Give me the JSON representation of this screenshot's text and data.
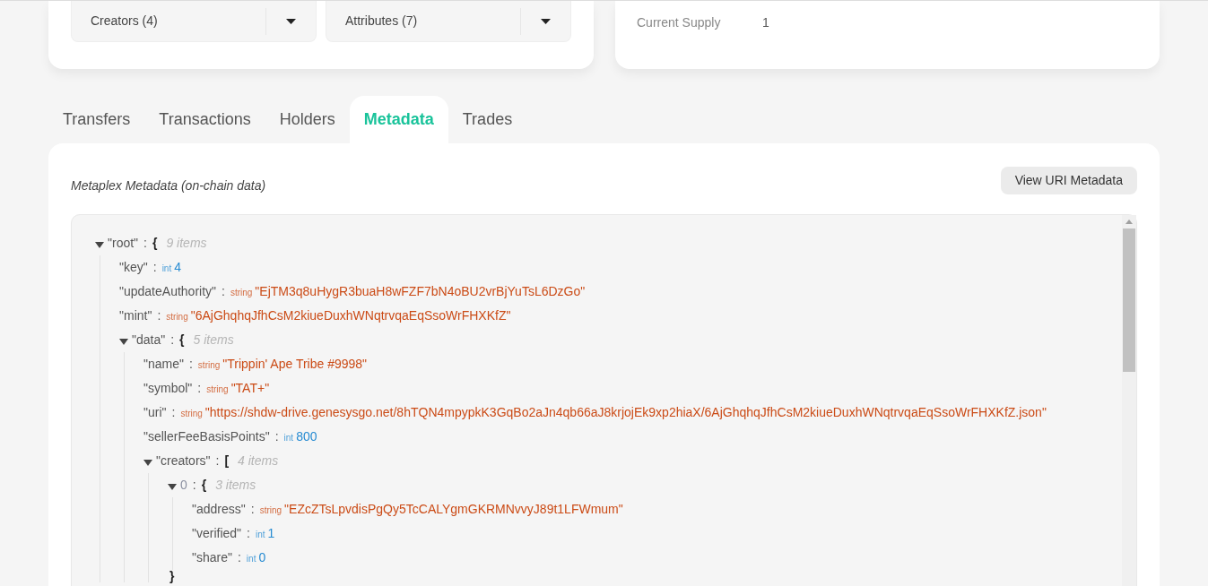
{
  "filters": [
    {
      "label": "Creators (4)"
    },
    {
      "label": "Attributes (7)"
    }
  ],
  "supply": {
    "label": "Current Supply",
    "value": "1"
  },
  "tabs": [
    {
      "label": "Transfers",
      "selected": false
    },
    {
      "label": "Transactions",
      "selected": false
    },
    {
      "label": "Holders",
      "selected": false
    },
    {
      "label": "Metadata",
      "selected": true
    },
    {
      "label": "Trades",
      "selected": false
    }
  ],
  "metadata": {
    "title": "Metaplex Metadata (on-chain data)",
    "button": "View URI Metadata",
    "tree": {
      "key": "\"root\"",
      "sep": ":",
      "kind": "object",
      "open": "{",
      "count": "9 items",
      "expanded": true,
      "children": [
        {
          "key": "\"key\"",
          "sep": ":",
          "kind": "int",
          "type": "int",
          "value": "4"
        },
        {
          "key": "\"updateAuthority\"",
          "sep": ":",
          "kind": "string",
          "type": "string",
          "value": "\"EjTM3q8uHygR3buaH8wFZF7bN4oBU2vrBjYuTsL6DzGo\""
        },
        {
          "key": "\"mint\"",
          "sep": ":",
          "kind": "string",
          "type": "string",
          "value": "\"6AjGhqhqJfhCsM2kiueDuxhWNqtrvqaEqSsoWrFHXKfZ\""
        },
        {
          "key": "\"data\"",
          "sep": ":",
          "kind": "object",
          "open": "{",
          "count": "5 items",
          "expanded": true,
          "children": [
            {
              "key": "\"name\"",
              "sep": ":",
              "kind": "string",
              "type": "string",
              "value": "\"Trippin' Ape Tribe #9998\""
            },
            {
              "key": "\"symbol\"",
              "sep": ":",
              "kind": "string",
              "type": "string",
              "value": "\"TAT+\""
            },
            {
              "key": "\"uri\"",
              "sep": ":",
              "kind": "string",
              "type": "string",
              "value": "\"https://shdw-drive.genesysgo.net/8hTQN4mpypkK3GqBo2aJn4qb66aJ8krjojEk9xp2hiaX/6AjGhqhqJfhCsM2kiueDuxhWNqtrvqaEqSsoWrFHXKfZ.json\""
            },
            {
              "key": "\"sellerFeeBasisPoints\"",
              "sep": ":",
              "kind": "int",
              "type": "int",
              "value": "800"
            },
            {
              "key": "\"creators\"",
              "sep": ":",
              "kind": "object",
              "open": "[",
              "count": "4 items",
              "expanded": true,
              "children": [
                {
                  "key": "0",
                  "sep": ":",
                  "kind": "object",
                  "open": "{",
                  "count": "3 items",
                  "expanded": true,
                  "close": "}",
                  "children": [
                    {
                      "key": "\"address\"",
                      "sep": ":",
                      "kind": "string",
                      "type": "string",
                      "value": "\"EZcZTsLpvdisPgQy5TcCALYgmGKRMNvvyJ89t1LFWmum\""
                    },
                    {
                      "key": "\"verified\"",
                      "sep": ":",
                      "kind": "int",
                      "type": "int",
                      "value": "1"
                    },
                    {
                      "key": "\"share\"",
                      "sep": ":",
                      "kind": "int",
                      "type": "int",
                      "value": "0"
                    }
                  ]
                }
              ]
            }
          ]
        }
      ]
    }
  }
}
